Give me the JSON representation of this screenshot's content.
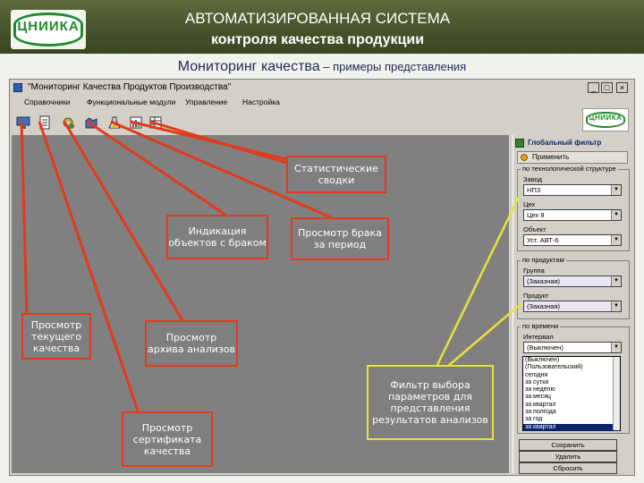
{
  "banner": {
    "title_line1": "АВТОМАТИЗИРОВАННАЯ СИСТЕМА",
    "title_line2": "контроля качества продукции",
    "logo_text": "ЦНИИКА"
  },
  "section": {
    "title_main": "Мониторинг качества",
    "title_rest": " – примеры представления"
  },
  "window": {
    "title": "\"Мониторинг Качества Продуктов Производства\"",
    "menu": [
      "Справочники",
      "Функциональные модули",
      "Управление",
      "Настройка"
    ],
    "company_logo_text": "ЦНИИКА"
  },
  "filter_panel": {
    "title": "Глобальный фильтр",
    "apply_label": "Применить",
    "group_object": {
      "title": "по технологической структуре",
      "plant_label": "Завод",
      "plant_value": "НПЗ",
      "shop_label": "Цех",
      "shop_value": "Цех 8",
      "object_label": "Объект",
      "object_value": "Уст. АВТ-6"
    },
    "group_product": {
      "title": "по продуктам",
      "group_label": "Группа",
      "group_value": "(Заказная)",
      "product_label": "Продукт",
      "product_value": "(Заказная)"
    },
    "group_time": {
      "title": "по времени",
      "interval_label": "Интервал",
      "interval_value": "(Выключен)",
      "options": [
        "(Выключен)",
        "(Пользовательский)",
        "сегодня",
        "за сутки",
        "за неделю",
        "за месяц",
        "за квартал",
        "за полгода",
        "за год",
        "за квартал"
      ],
      "highlighted_index": 9
    },
    "buttons": [
      "Сохранить",
      "Удалить",
      "Сбросить"
    ]
  },
  "callouts": {
    "stat": "Статистические сводки",
    "defects_objects": "Индикация объектов с браком",
    "defects_period": "Просмотр брака за период",
    "current_quality": "Просмотр текущего качества",
    "archive": "Просмотр архива анализов",
    "certificate": "Просмотр сертификата качества",
    "filter": "Фильтр выбора параметров для представления результатов анализов"
  },
  "colors": {
    "banner": "#46532c",
    "callout_border_red": "#e23a1c",
    "callout_border_yellow": "#e8e23a",
    "workspace": "#808080"
  }
}
